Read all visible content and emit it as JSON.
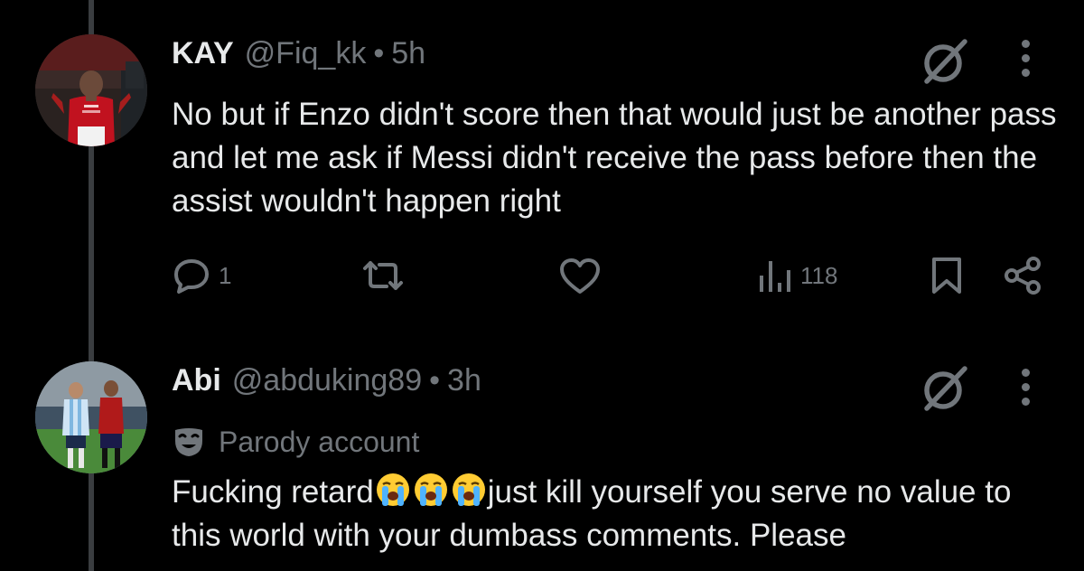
{
  "thread": {
    "tweets": [
      {
        "name": "KAY",
        "handle": "@Fiq_kk",
        "separator": "•",
        "time": "5h",
        "text": "No but if Enzo didn't score then that would just be another pass and let me ask if Messi didn't receive the pass before then the assist wouldn't happen right",
        "reply_count": "1",
        "retweet_count": "",
        "like_count": "",
        "view_count": "118",
        "avatar_icon": "avatar-photo-red-jersey-player"
      },
      {
        "name": "Abi",
        "handle": "@abduking89",
        "separator": "•",
        "time": "3h",
        "badge_label": "Parody account",
        "text_before_emoji": "Fucking retard",
        "emoji": "loudly-crying-face x3",
        "text_after_emoji": "just kill yourself you serve no value to this world with your dumbass comments. Please",
        "avatar_icon": "avatar-photo-two-football-players"
      }
    ]
  },
  "icons": {
    "reply": "speech-bubble-icon",
    "retweet": "retweet-arrows-icon",
    "like": "heart-icon",
    "views": "bar-chart-icon",
    "bookmark": "bookmark-icon",
    "share": "share-nodes-icon",
    "grok": "grok-slash-circle-icon",
    "more": "vertical-ellipsis-icon",
    "parody": "theater-mask-icon"
  },
  "colors": {
    "background": "#000000",
    "primary_text": "#e7e9ea",
    "secondary_text": "#71767b",
    "thread_line": "#3a3d40"
  }
}
